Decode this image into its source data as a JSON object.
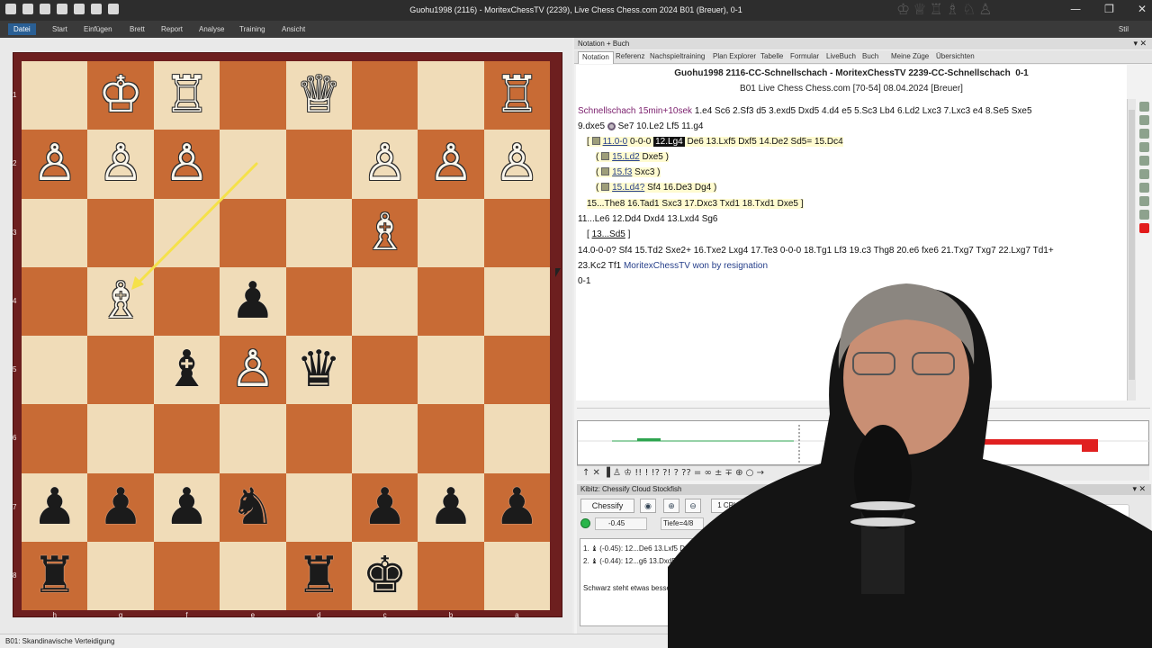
{
  "window": {
    "title": "Guohu1998 (2116) - MoritexChessTV (2239), Live Chess Chess.com 2024  B01 (Breuer), 0-1",
    "quick_access_icons": [
      "save-icon",
      "undo-icon",
      "redo-icon",
      "settings-icon",
      "pen-icon",
      "heart-icon",
      "dropdown-icon"
    ],
    "piece_icons": "♔♕♖♗♘♙",
    "controls": {
      "minimize": "—",
      "restore": "❐",
      "close": "✕"
    }
  },
  "menu": {
    "items": [
      "Datei",
      "Start",
      "Einfügen",
      "Brett",
      "Report",
      "Analyse",
      "Training",
      "Ansicht"
    ],
    "stil": "Stil"
  },
  "board": {
    "ranks": [
      "1",
      "2",
      "3",
      "4",
      "5",
      "6",
      "7",
      "8"
    ],
    "files": [
      "h",
      "g",
      "f",
      "e",
      "d",
      "c",
      "b",
      "a"
    ],
    "squares": [
      [
        "",
        "♔w",
        "♖w",
        "",
        "♕w",
        "",
        "",
        "♖w"
      ],
      [
        "♙w",
        "♙w",
        "♙w",
        "",
        "",
        "♙w",
        "♙w",
        "♙w"
      ],
      [
        "",
        "",
        "",
        "",
        "",
        "♗w",
        "",
        ""
      ],
      [
        "",
        "♗w",
        "",
        "♟b",
        "",
        "",
        "",
        ""
      ],
      [
        "",
        "",
        "♝b",
        "♙w",
        "♛b",
        "",
        "",
        ""
      ],
      [
        "",
        "",
        "",
        "",
        "",
        "",
        "",
        ""
      ],
      [
        "♟b",
        "♟b",
        "♟b",
        "♞b",
        "",
        "♟b",
        "♟b",
        "♟b"
      ],
      [
        "♜b",
        "",
        "",
        "",
        "♜b",
        "♚b",
        "",
        ""
      ]
    ],
    "arrow_color": "#f5e14a",
    "light_color": "#f0dcb8",
    "dark_color": "#c86b35"
  },
  "statusbar": {
    "text": "B01: Skandinavische Verteidigung"
  },
  "notation_panel": {
    "title": "Notation + Buch",
    "tabs": [
      "Notation",
      "Referenz",
      "Nachspieltraining",
      "Plan Explorer",
      "Tabelle",
      "Formular",
      "LiveBuch",
      "Buch",
      "Meine Züge",
      "Übersichten"
    ],
    "header_line1": "Guohu1998 2116-CC-Schnellschach - MoritexChessTV 2239-CC-Schnellschach",
    "header_result": "0-1",
    "header_line2": "B01 Live Chess Chess.com [70-54] 08.04.2024 [Breuer]",
    "lines": {
      "l1_comment": "Schnellschach 15min+10sek",
      "l1_moves": "1.e4 Sc6 2.Sf3 d5 3.exd5 Dxd5 4.d4 e5 5.Sc3 Lb4 6.Ld2 Lxc3 7.Lxc3 e4 8.Se5 Sxe5",
      "l2a": "9.dxe5",
      "l2b": "Se7 10.Le2 Lf5 11.g4",
      "l3_open": "[",
      "l3_move": "11.0-0",
      "l3_mid": "0-0-0",
      "l3_hl": "12.Lg4",
      "l3_rest": "De6 13.Lxf5 Dxf5 14.De2 Sd5= 15.Dc4",
      "v1_open": "(",
      "v1_move": "15.Ld2",
      "v1_rest": "Dxe5 )",
      "v2_open": "(",
      "v2_move": "15.f3",
      "v2_rest": "Sxc3 )",
      "v3_open": "(",
      "v3_move": "15.Ld4?",
      "v3_rest": "Sf4 16.De3 Dg4 )",
      "l7": "15...The8 16.Tad1 Sxc3 17.Dxc3 Txd1 18.Txd1 Dxe5 ]",
      "l8": "11...Le6 12.Dd4 Dxd4 13.Lxd4 Sg6",
      "l9_open": "[",
      "l9_move": "13...Sd5",
      "l9_close": "]",
      "l10": "14.0-0-0? Sf4 15.Td2 Sxe2+ 16.Txe2 Lxg4 17.Te3 0-0-0 18.Tg1 Lf3 19.c3 Thg8 20.e6 fxe6 21.Txg7 Txg7 22.Lxg7 Td1+",
      "l11_moves": "23.Kc2 Tf1",
      "l11_comment": "MoritexChessTV won by resignation",
      "l12": "0-1"
    }
  },
  "move_toolbar": {
    "symbols": "↑ ✕ ▐ ♙ ♔ !! ! !? ?! ? ?? = ∞ ± ∓ ⊕ ○ →"
  },
  "kibitz": {
    "title": "Kibitz: Chessify Cloud Stockfish",
    "engine": "Chessify",
    "cpu": "1 CPU",
    "eval": "-0.45",
    "depth": "Tiefe=4/8",
    "lines": [
      "1. ♝ (-0.45): 12...De6 13.Lxf5 Dxf5 14.D",
      "2. ♝ (-0.44): 12...g6 13.Dxd5 Sxd5 14"
    ],
    "assessment": "Schwarz steht etwas besser."
  }
}
